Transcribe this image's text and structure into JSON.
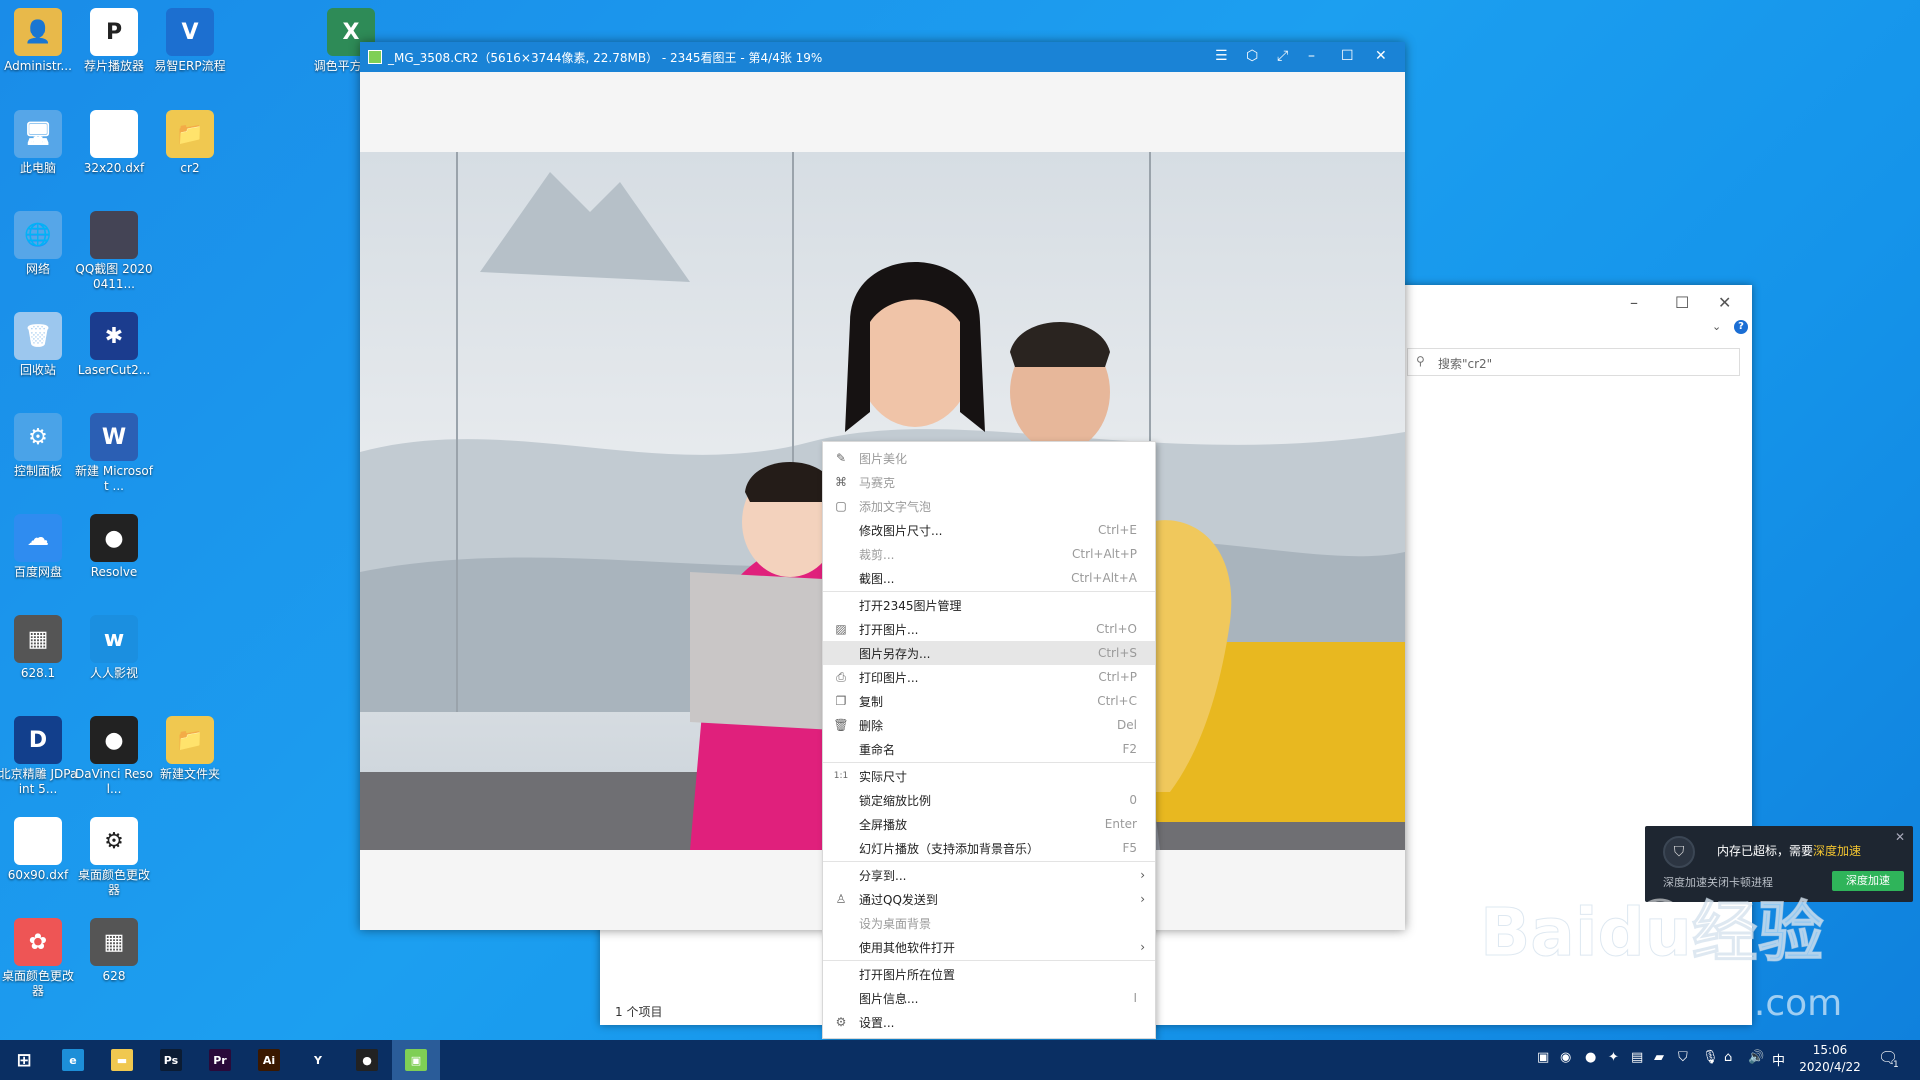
{
  "desktop": {
    "icons": [
      {
        "label": "Administr...",
        "glyph": "👤",
        "color": "#e8b94a"
      },
      {
        "label": "荐片播放器",
        "glyph": "P",
        "color": "#ffffff"
      },
      {
        "label": "易智ERP流程",
        "glyph": "V",
        "color": "#1c6fd0"
      },
      {
        "label": "调色平方 111",
        "glyph": "X",
        "color": "#2e8b57"
      },
      {
        "label": "此电脑",
        "glyph": "🖥",
        "color": "#56a6e8"
      },
      {
        "label": "32x20.dxf",
        "glyph": "",
        "color": "#ffffff"
      },
      {
        "label": "cr2",
        "glyph": "📁",
        "color": "#f0c850"
      },
      {
        "label": "网络",
        "glyph": "🌐",
        "color": "#56a6e8"
      },
      {
        "label": "QQ截图 20200411...",
        "glyph": "",
        "color": "#445"
      },
      {
        "label": "回收站",
        "glyph": "🗑",
        "color": "#9cc7ee"
      },
      {
        "label": "LaserCut2...",
        "glyph": "✱",
        "color": "#1b3c8e"
      },
      {
        "label": "控制面板",
        "glyph": "⚙",
        "color": "#4aa3e8"
      },
      {
        "label": "新建 Microsoft ...",
        "glyph": "W",
        "color": "#2b5fb4"
      },
      {
        "label": "百度网盘",
        "glyph": "☁",
        "color": "#2f8cf0"
      },
      {
        "label": "Resolve",
        "glyph": "●",
        "color": "#222"
      },
      {
        "label": "628.1",
        "glyph": "▦",
        "color": "#555"
      },
      {
        "label": "人人影视",
        "glyph": "w",
        "color": "#1b8fe0"
      },
      {
        "label": "北京精雕 JDPaint 5...",
        "glyph": "D",
        "color": "#123f8c"
      },
      {
        "label": "DaVinci Resol...",
        "glyph": "●",
        "color": "#222"
      },
      {
        "label": "新建文件夹",
        "glyph": "📁",
        "color": "#f0c850"
      },
      {
        "label": "60x90.dxf",
        "glyph": "",
        "color": "#ffffff"
      },
      {
        "label": "桌面颜色更改器",
        "glyph": "⚙",
        "color": "#ffffff"
      },
      {
        "label": "桌面颜色更改器",
        "glyph": "✿",
        "color": "#e55"
      },
      {
        "label": "628",
        "glyph": "▦",
        "color": "#555"
      }
    ]
  },
  "viewer": {
    "title": "_MG_3508.CR2（5616×3744像素, 22.78MB） - 2345看图王 - 第4/4张 19%"
  },
  "explorer": {
    "search_placeholder": "搜索\"cr2\"",
    "status": "1 个项目"
  },
  "context_menu": {
    "groups": [
      [
        {
          "label": "图片美化",
          "shortcut": "",
          "icon": "edit-icon",
          "disabled": true
        },
        {
          "label": "马赛克",
          "shortcut": "",
          "icon": "mosaic-icon",
          "disabled": true
        },
        {
          "label": "添加文字气泡",
          "shortcut": "",
          "icon": "bubble-icon",
          "disabled": true
        },
        {
          "label": "修改图片尺寸...",
          "shortcut": "Ctrl+E",
          "icon": "",
          "disabled": false
        },
        {
          "label": "裁剪...",
          "shortcut": "Ctrl+Alt+P",
          "icon": "",
          "disabled": true
        },
        {
          "label": "截图...",
          "shortcut": "Ctrl+Alt+A",
          "icon": "",
          "disabled": false
        }
      ],
      [
        {
          "label": "打开2345图片管理",
          "shortcut": "",
          "icon": "",
          "disabled": false
        },
        {
          "label": "打开图片...",
          "shortcut": "Ctrl+O",
          "icon": "image-icon",
          "disabled": false
        },
        {
          "label": "图片另存为...",
          "shortcut": "Ctrl+S",
          "icon": "",
          "disabled": false,
          "highlighted": true
        },
        {
          "label": "打印图片...",
          "shortcut": "Ctrl+P",
          "icon": "printer-icon",
          "disabled": false
        },
        {
          "label": "复制",
          "shortcut": "Ctrl+C",
          "icon": "copy-icon",
          "disabled": false
        },
        {
          "label": "删除",
          "shortcut": "Del",
          "icon": "trash-icon",
          "disabled": false
        },
        {
          "label": "重命名",
          "shortcut": "F2",
          "icon": "",
          "disabled": false
        }
      ],
      [
        {
          "label": "实际尺寸",
          "shortcut": "",
          "icon": "actual-size-icon",
          "disabled": false
        },
        {
          "label": "锁定缩放比例",
          "shortcut": "0",
          "icon": "",
          "disabled": false
        },
        {
          "label": "全屏播放",
          "shortcut": "Enter",
          "icon": "",
          "disabled": false
        },
        {
          "label": "幻灯片播放（支持添加背景音乐）",
          "shortcut": "F5",
          "icon": "",
          "disabled": false
        }
      ],
      [
        {
          "label": "分享到...",
          "shortcut": "",
          "icon": "",
          "disabled": false,
          "submenu": true
        },
        {
          "label": "通过QQ发送到",
          "shortcut": "",
          "icon": "qq-icon",
          "disabled": false,
          "submenu": true
        },
        {
          "label": "设为桌面背景",
          "shortcut": "",
          "icon": "",
          "disabled": true
        },
        {
          "label": "使用其他软件打开",
          "shortcut": "",
          "icon": "",
          "disabled": false,
          "submenu": true
        }
      ],
      [
        {
          "label": "打开图片所在位置",
          "shortcut": "",
          "icon": "",
          "disabled": false
        },
        {
          "label": "图片信息...",
          "shortcut": "I",
          "icon": "",
          "disabled": false
        },
        {
          "label": "设置...",
          "shortcut": "",
          "icon": "gear-icon",
          "disabled": false
        }
      ]
    ]
  },
  "notification": {
    "text_prefix": "内存已超标，需要",
    "text_highlight": "深度加速",
    "subtext": "深度加速关闭卡顿进程",
    "button": "深度加速"
  },
  "taskbar": {
    "apps": [
      {
        "name": "start-button",
        "glyph": "⊞",
        "bg": "transparent"
      },
      {
        "name": "edge-app",
        "glyph": "e",
        "bg": "#1d8fd8"
      },
      {
        "name": "file-explorer-app",
        "glyph": "▬",
        "bg": "#f0c850"
      },
      {
        "name": "photoshop-app",
        "glyph": "Ps",
        "bg": "#0b1c33"
      },
      {
        "name": "premiere-app",
        "glyph": "Pr",
        "bg": "#2a0a3a"
      },
      {
        "name": "illustrator-app",
        "glyph": "Ai",
        "bg": "#3a1800"
      },
      {
        "name": "erp-app",
        "glyph": "Y",
        "bg": "transparent"
      },
      {
        "name": "davinci-app",
        "glyph": "●",
        "bg": "#222"
      },
      {
        "name": "2345-viewer-app",
        "glyph": "▣",
        "bg": "#7fcf55"
      }
    ],
    "ime": "中",
    "time": "15:06",
    "date": "2020/4/22",
    "notification_count": "1"
  },
  "watermark": {
    "brand": "Baidu经验",
    "url": "jingyan.baidu.com"
  }
}
